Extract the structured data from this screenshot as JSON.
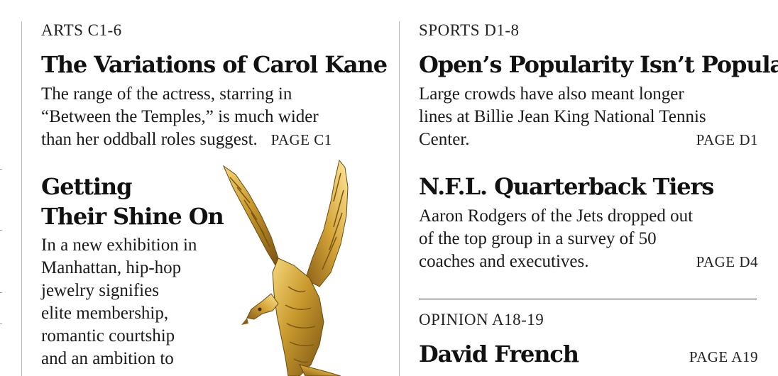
{
  "arts": {
    "section_label": "ARTS C1-6",
    "story1": {
      "headline": "The Variations of Carol Kane",
      "lines": [
        "The range of the actress, starring in",
        "“Between the Temples,” is much wider",
        "than her oddball roles suggest."
      ],
      "page": "PAGE C1"
    },
    "story2": {
      "headline_lines": [
        "Getting",
        "Their Shine On"
      ],
      "lines": [
        "In a new exhibition in",
        "Manhattan, hip-hop",
        "jewelry signifies",
        "elite membership,",
        "romantic courtship",
        "and an ambition to"
      ],
      "image_icon": "gold-eagle-icon"
    }
  },
  "sports": {
    "section_label": "SPORTS D1-8",
    "story1": {
      "headline": "Open’s Popularity Isn’t Popular",
      "lines": [
        "Large crowds have also meant longer",
        "lines at Billie Jean King National Tennis",
        "Center."
      ],
      "page": "PAGE D1"
    },
    "story2": {
      "headline": "N.F.L. Quarterback Tiers",
      "lines": [
        "Aaron Rodgers of the Jets dropped out",
        "of the top group in a survey of 50",
        "coaches and executives."
      ],
      "page": "PAGE D4"
    }
  },
  "opinion": {
    "section_label": "OPINION A18-19",
    "story1": {
      "headline": "David French",
      "page": "PAGE A19"
    }
  },
  "colors": {
    "gold": "#c99a2e",
    "text": "#121212",
    "rule": "#bdbdbd"
  }
}
